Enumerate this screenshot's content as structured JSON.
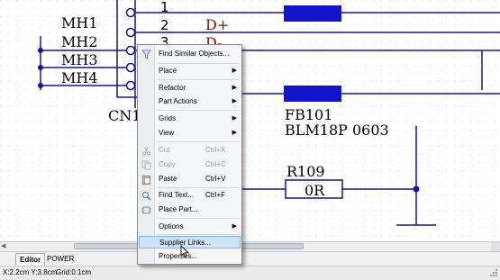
{
  "schematic": {
    "connector": {
      "pins": [
        "1",
        "2",
        "3"
      ],
      "nets": [
        "D+",
        "D-"
      ],
      "mounting_holes": [
        "MH1",
        "MH2",
        "MH3",
        "MH4"
      ],
      "ref": "CN1"
    },
    "ferrite": {
      "ref": "FB101",
      "value": "BLM18P 0603"
    },
    "resistor": {
      "ref": "R109",
      "value": "0R"
    },
    "colors": {
      "wire": "#16168e",
      "net_text": "#8a1010",
      "body_fill": "#1313c8",
      "grid": "#f0c8c8"
    }
  },
  "context_menu": {
    "items": [
      {
        "label": "Find Similar Objects...",
        "icon": "funnel-icon"
      },
      {
        "label": "Place",
        "submenu": true
      },
      {
        "label": "Refactor",
        "submenu": true
      },
      {
        "label": "Part Actions",
        "submenu": true
      },
      {
        "label": "Grids",
        "submenu": true
      },
      {
        "label": "View",
        "submenu": true
      },
      {
        "label": "Cut",
        "shortcut": "Ctrl+X",
        "disabled": true,
        "icon": "scissors-icon"
      },
      {
        "label": "Copy",
        "shortcut": "Ctrl+C",
        "disabled": true,
        "icon": "copy-icon"
      },
      {
        "label": "Paste",
        "shortcut": "Ctrl+V",
        "icon": "paste-icon"
      },
      {
        "label": "Find Text...",
        "shortcut": "Ctrl+F",
        "icon": "search-icon"
      },
      {
        "label": "Place Part...",
        "icon": "part-icon"
      },
      {
        "label": "Options",
        "submenu": true
      },
      {
        "label": "Supplier Links...",
        "highlighted": true
      },
      {
        "label": "Properties..."
      }
    ]
  },
  "tabs": [
    "Editor",
    "POWER"
  ],
  "status_bar": {
    "coords": "X:2.2cm Y:3.8cm",
    "grid": "Grid:0.1cm"
  }
}
